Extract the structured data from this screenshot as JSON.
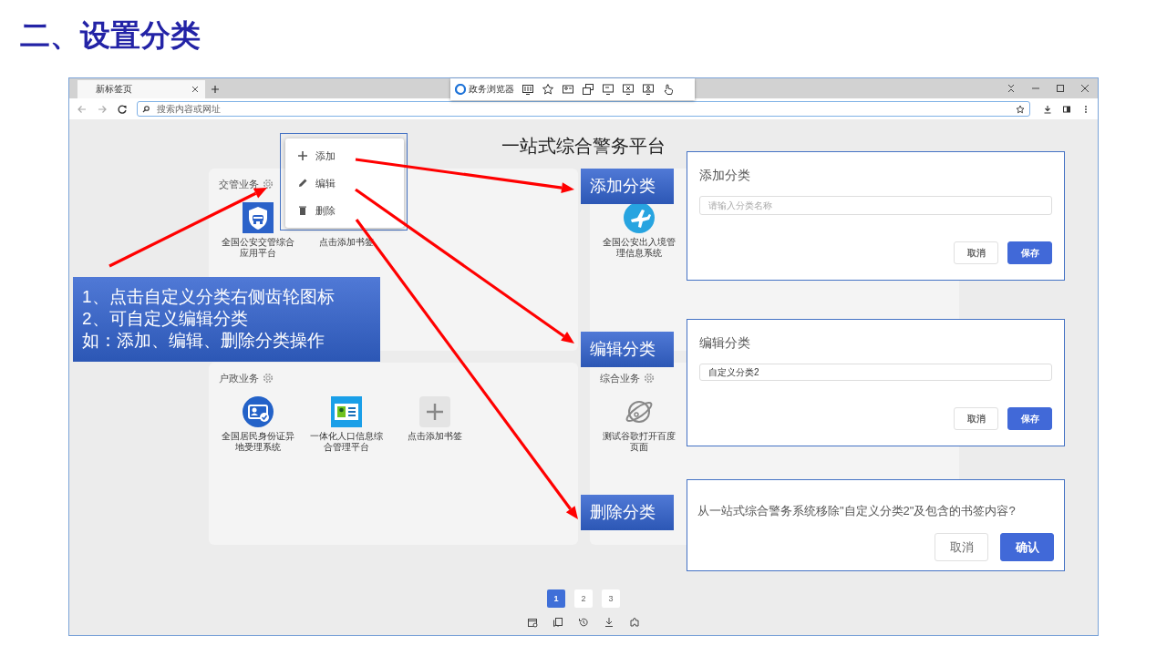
{
  "slide_title": "二、设置分类",
  "browser": {
    "tab": {
      "title": "新标签页",
      "selected": true
    },
    "extension_bar": {
      "label": "政务浏览器"
    },
    "address_bar": {
      "placeholder": "搜索内容或网址"
    }
  },
  "page": {
    "title": "一站式综合警务平台",
    "categories": [
      {
        "name": "交管业务",
        "bookmarks": [
          {
            "label": "全国公安交管综合应用平台",
            "kind": "shield-car"
          },
          {
            "label": "点击添加书签"
          }
        ]
      },
      {
        "bookmarks": [
          {
            "label": "全国公安出入境管理信息系统",
            "kind": "plane"
          }
        ]
      },
      {
        "name": "户政业务",
        "bookmarks": [
          {
            "label": "全国居民身份证异地受理系统",
            "kind": "id-card"
          },
          {
            "label": "一体化人口信息综合管理平台",
            "kind": "profile-card"
          },
          {
            "label": "点击添加书签",
            "kind": "add"
          }
        ]
      },
      {
        "name": "综合业务",
        "bookmarks": [
          {
            "label": "测试谷歌打开百度页面",
            "kind": "planet"
          }
        ]
      }
    ],
    "pagination": [
      {
        "label": "1",
        "selected": true
      },
      {
        "label": "2",
        "selected": false
      },
      {
        "label": "3",
        "selected": false
      }
    ]
  },
  "context_menu": [
    {
      "label": "添加",
      "kind": "add"
    },
    {
      "label": "编辑",
      "kind": "edit"
    },
    {
      "label": "删除",
      "kind": "delete"
    }
  ],
  "callouts": {
    "steps": [
      "1、点击自定义分类右侧齿轮图标",
      "2、可自定义编辑分类",
      "如：添加、编辑、删除分类操作"
    ],
    "labels": [
      "添加分类",
      "编辑分类",
      "删除分类"
    ]
  },
  "dialogs": [
    {
      "kind": "form",
      "title": "添加分类",
      "placeholder": "请输入分类名称",
      "buttons": [
        "取消",
        "保存"
      ]
    },
    {
      "kind": "form",
      "title": "编辑分类",
      "value": "自定义分类2",
      "buttons": [
        "取消",
        "保存"
      ]
    },
    {
      "kind": "confirm",
      "message": "从一站式综合警务系统移除\"自定义分类2\"及包含的书签内容?",
      "buttons": [
        "取消",
        "确认"
      ]
    }
  ]
}
